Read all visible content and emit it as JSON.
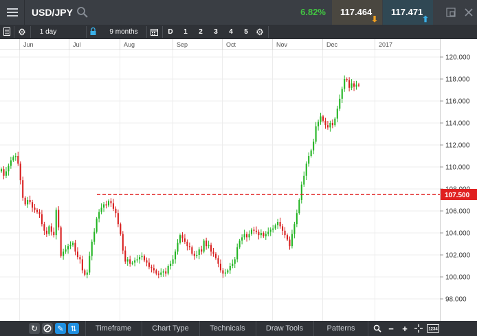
{
  "header": {
    "symbol": "USD/JPY",
    "change": "6.82%",
    "sell_price": "117.464",
    "buy_price": "117.471"
  },
  "toolbar": {
    "interval": "1 day",
    "range": "9 months",
    "quick": [
      "D",
      "1",
      "2",
      "3",
      "4",
      "5"
    ]
  },
  "months": [
    "Jun",
    "Jul",
    "Aug",
    "Sep",
    "Oct",
    "Nov",
    "Dec",
    "2017"
  ],
  "chart_data": {
    "type": "candlestick",
    "yticks": [
      "120.000",
      "118.000",
      "116.000",
      "114.000",
      "112.000",
      "110.000",
      "108.000",
      "106.000",
      "104.000",
      "102.000",
      "100.000",
      "98.000"
    ],
    "ylim": [
      96.0,
      120.5
    ],
    "colors": {
      "up": "#22b422",
      "down": "#d81e1e"
    },
    "level_line": {
      "value": 107.5,
      "label": "107.500",
      "color": "#e02020"
    },
    "closes": [
      109.8,
      109.2,
      109.6,
      110.1,
      110.6,
      110.9,
      111.0,
      110.3,
      108.8,
      107.2,
      106.6,
      107.0,
      106.8,
      106.3,
      106.1,
      105.9,
      105.7,
      104.8,
      104.2,
      103.9,
      104.6,
      104.1,
      103.8,
      106.1,
      104.5,
      101.9,
      102.3,
      102.5,
      102.8,
      102.9,
      103.1,
      102.3,
      101.8,
      101.6,
      100.6,
      100.2,
      100.4,
      101.9,
      103.2,
      104.1,
      105.3,
      105.9,
      106.3,
      106.6,
      106.5,
      106.9,
      106.7,
      106.2,
      105.8,
      104.8,
      103.9,
      102.4,
      101.4,
      101.6,
      101.2,
      101.3,
      101.5,
      101.6,
      101.8,
      101.9,
      101.5,
      101.3,
      100.9,
      100.8,
      100.6,
      100.3,
      100.2,
      100.4,
      100.5,
      100.3,
      101.0,
      101.2,
      101.6,
      102.3,
      103.1,
      103.8,
      103.5,
      103.2,
      102.8,
      102.7,
      102.1,
      101.9,
      102.0,
      102.5,
      102.3,
      103.3,
      102.8,
      102.9,
      102.3,
      102.1,
      101.7,
      101.2,
      100.6,
      100.3,
      100.4,
      100.6,
      101.0,
      101.2,
      101.6,
      102.7,
      103.3,
      103.6,
      103.9,
      103.6,
      103.9,
      104.3,
      104.2,
      104.1,
      103.8,
      104.0,
      103.7,
      103.9,
      104.1,
      104.3,
      104.4,
      104.7,
      105.0,
      104.6,
      104.2,
      103.8,
      103.4,
      102.8,
      103.9,
      104.8,
      105.8,
      107.0,
      108.4,
      109.2,
      110.3,
      111.0,
      111.5,
      112.3,
      113.7,
      114.1,
      114.6,
      114.2,
      113.8,
      113.6,
      114.0,
      113.8,
      114.4,
      115.3,
      116.2,
      117.1,
      118.0,
      117.9,
      117.2,
      117.6,
      117.3,
      117.5,
      117.4
    ]
  },
  "bottom": {
    "tabs": [
      "Timeframe",
      "Chart Type",
      "Technicals",
      "Draw Tools",
      "Patterns"
    ],
    "reset_label": "1234"
  }
}
